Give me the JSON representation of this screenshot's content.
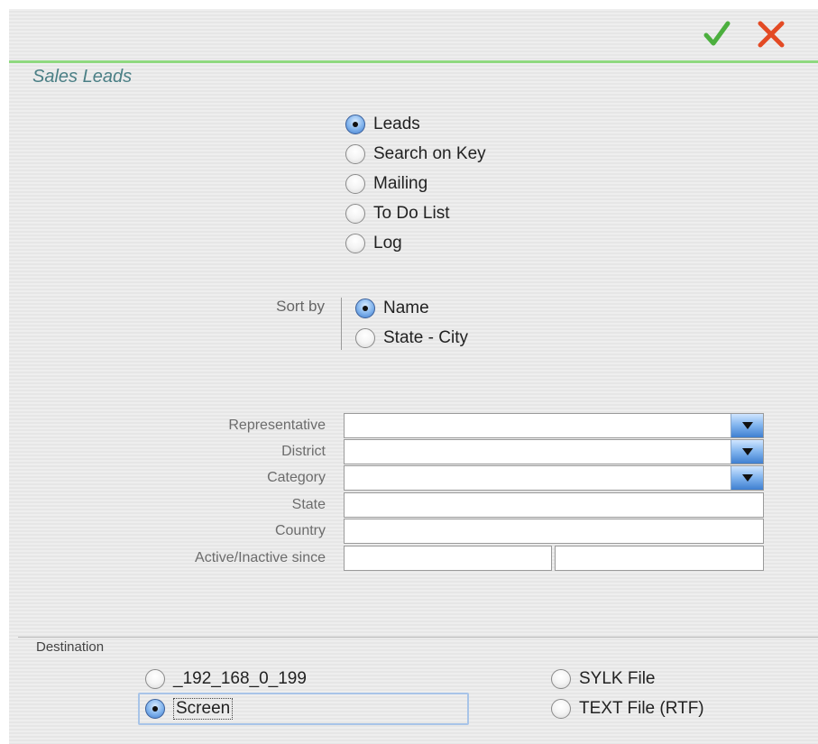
{
  "toolbar": {
    "ok_icon": "checkmark-icon",
    "cancel_icon": "close-x-icon",
    "ok_color": "#4caf3e",
    "cancel_color": "#e34a24"
  },
  "form": {
    "title": "Sales Leads"
  },
  "report_options": [
    {
      "label": "Leads",
      "selected": true
    },
    {
      "label": "Search on Key",
      "selected": false
    },
    {
      "label": "Mailing",
      "selected": false
    },
    {
      "label": "To Do List",
      "selected": false
    },
    {
      "label": "Log",
      "selected": false
    }
  ],
  "sort": {
    "label": "Sort by",
    "options": [
      {
        "label": "Name",
        "selected": true
      },
      {
        "label": "State - City",
        "selected": false
      }
    ]
  },
  "filters": {
    "representative": {
      "label": "Representative",
      "value": ""
    },
    "district": {
      "label": "District",
      "value": ""
    },
    "category": {
      "label": "Category",
      "value": ""
    },
    "state": {
      "label": "State",
      "value": ""
    },
    "country": {
      "label": "Country",
      "value": ""
    },
    "active_since": {
      "label": "Active/Inactive since",
      "from": "",
      "to": ""
    }
  },
  "destination": {
    "title": "Destination",
    "options": [
      {
        "label": "_192_168_0_199",
        "selected": false
      },
      {
        "label": "Screen",
        "selected": true
      },
      {
        "label": "SYLK File",
        "selected": false
      },
      {
        "label": "TEXT File (RTF)",
        "selected": false
      }
    ]
  },
  "colors": {
    "accent_line": "#8fd97f",
    "title_color": "#4a7f85",
    "radio_selected": "#5a93dd"
  }
}
